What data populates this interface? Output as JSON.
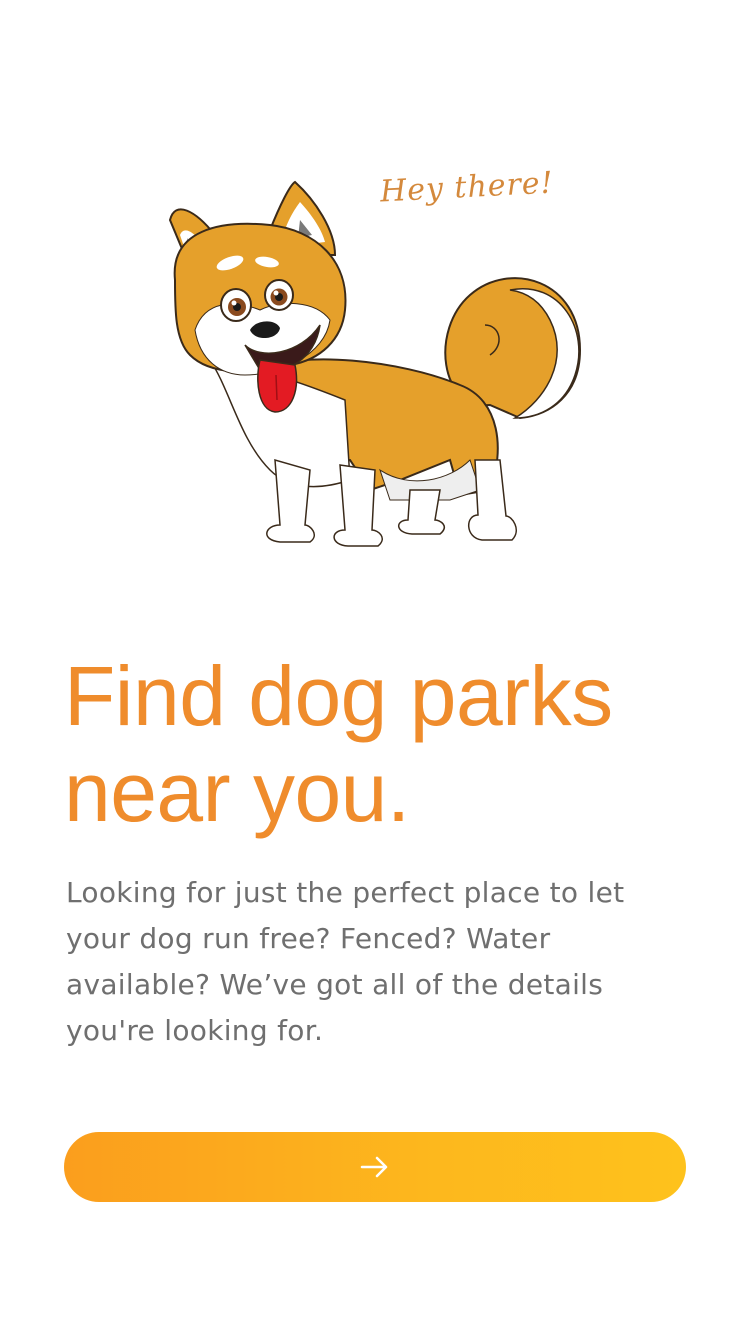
{
  "illustration": {
    "greeting": "Hey there!",
    "subject": "shiba-dog-illustration"
  },
  "headline": {
    "line1": "Find dog parks",
    "line2": "near you."
  },
  "description": "Looking for just the perfect place to let your dog run free? Fenced? Water available? We’ve got all of the details you're looking for.",
  "cta": {
    "icon": "arrow-right-icon"
  },
  "colors": {
    "accent": "#ef8c2c",
    "button_start": "#fb9e1d",
    "button_end": "#fec21c",
    "body_text": "#6f6f6f",
    "dog_fur": "#e5a02b"
  }
}
